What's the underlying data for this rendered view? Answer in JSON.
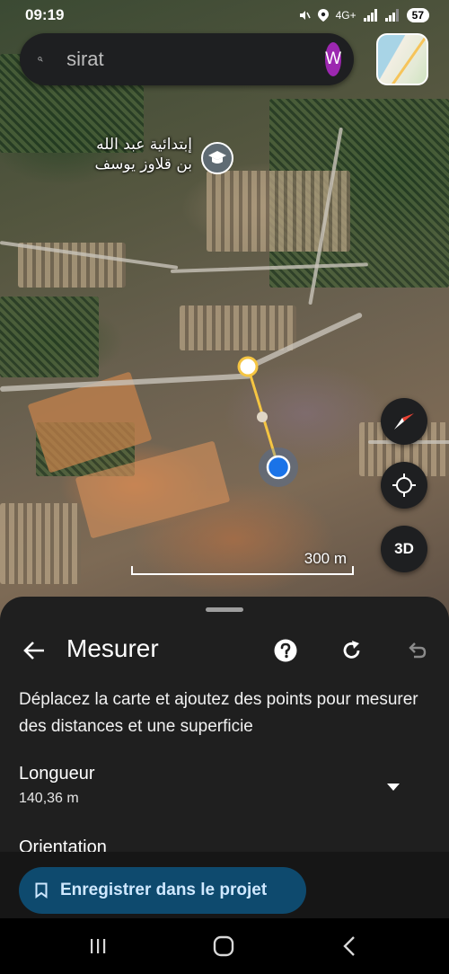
{
  "status_bar": {
    "time": "09:19",
    "network": "4G+",
    "battery": "57"
  },
  "search": {
    "value": "sirat",
    "avatar_letter": "W"
  },
  "map": {
    "poi_label_line1": "إبتدائية عبد الله",
    "poi_label_line2": "بن قلاوز يوسف",
    "scale_label": "300 m",
    "btn_3d": "3D"
  },
  "sheet": {
    "title": "Mesurer",
    "instructions": "Déplacez la carte et ajoutez des points pour mesurer des distances et une superficie",
    "length_label": "Longueur",
    "length_value": "140,36 m",
    "orientation_label": "Orientation",
    "save_button": "Enregistrer dans le projet"
  },
  "colors": {
    "accent_blue": "#1a73e8",
    "measure_line": "#f5c542",
    "avatar_bg": "#9c27b0",
    "save_bg": "#0e4a6e"
  }
}
